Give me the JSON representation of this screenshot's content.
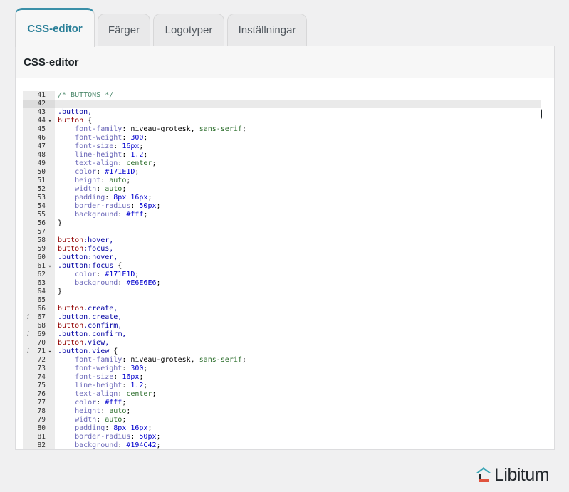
{
  "tabs": [
    {
      "label": "CSS-editor",
      "active": true
    },
    {
      "label": "Färger",
      "active": false
    },
    {
      "label": "Logotyper",
      "active": false
    },
    {
      "label": "Inställningar",
      "active": false
    }
  ],
  "panel": {
    "title": "CSS-editor"
  },
  "editor": {
    "lines": [
      {
        "n": "41",
        "parts": [
          [
            "/* BUTTONS */",
            "comment"
          ]
        ]
      },
      {
        "n": "42",
        "parts": []
      },
      {
        "n": "43",
        "parts": [
          [
            ".button,",
            "sel"
          ]
        ]
      },
      {
        "n": "44",
        "fold": true,
        "parts": [
          [
            "button",
            "tag"
          ],
          [
            " {",
            "plain"
          ]
        ]
      },
      {
        "n": "45",
        "parts": [
          [
            "    font-family",
            "prop"
          ],
          [
            ": niveau-grotesk, ",
            "plain"
          ],
          [
            "sans-serif",
            "str"
          ],
          [
            ";",
            "plain"
          ]
        ]
      },
      {
        "n": "46",
        "parts": [
          [
            "    font-weight",
            "prop"
          ],
          [
            ": ",
            "plain"
          ],
          [
            "300",
            "num"
          ],
          [
            ";",
            "plain"
          ]
        ]
      },
      {
        "n": "47",
        "parts": [
          [
            "    font-size",
            "prop"
          ],
          [
            ": ",
            "plain"
          ],
          [
            "16px",
            "num"
          ],
          [
            ";",
            "plain"
          ]
        ]
      },
      {
        "n": "48",
        "parts": [
          [
            "    line-height",
            "prop"
          ],
          [
            ": ",
            "plain"
          ],
          [
            "1.2",
            "num"
          ],
          [
            ";",
            "plain"
          ]
        ]
      },
      {
        "n": "49",
        "parts": [
          [
            "    text-align",
            "prop"
          ],
          [
            ": ",
            "plain"
          ],
          [
            "center",
            "str"
          ],
          [
            ";",
            "plain"
          ]
        ]
      },
      {
        "n": "50",
        "parts": [
          [
            "    color",
            "prop"
          ],
          [
            ": ",
            "plain"
          ],
          [
            "#171E1D",
            "num"
          ],
          [
            ";",
            "plain"
          ]
        ]
      },
      {
        "n": "51",
        "parts": [
          [
            "    height",
            "prop"
          ],
          [
            ": ",
            "plain"
          ],
          [
            "auto",
            "str"
          ],
          [
            ";",
            "plain"
          ]
        ]
      },
      {
        "n": "52",
        "parts": [
          [
            "    width",
            "prop"
          ],
          [
            ": ",
            "plain"
          ],
          [
            "auto",
            "str"
          ],
          [
            ";",
            "plain"
          ]
        ]
      },
      {
        "n": "53",
        "parts": [
          [
            "    padding",
            "prop"
          ],
          [
            ": ",
            "plain"
          ],
          [
            "8px 16px",
            "num"
          ],
          [
            ";",
            "plain"
          ]
        ]
      },
      {
        "n": "54",
        "parts": [
          [
            "    border-radius",
            "prop"
          ],
          [
            ": ",
            "plain"
          ],
          [
            "50px",
            "num"
          ],
          [
            ";",
            "plain"
          ]
        ]
      },
      {
        "n": "55",
        "parts": [
          [
            "    background",
            "prop"
          ],
          [
            ": ",
            "plain"
          ],
          [
            "#fff",
            "num"
          ],
          [
            ";",
            "plain"
          ]
        ]
      },
      {
        "n": "56",
        "parts": [
          [
            "}",
            "plain"
          ]
        ]
      },
      {
        "n": "57",
        "parts": []
      },
      {
        "n": "58",
        "parts": [
          [
            "button",
            "tag"
          ],
          [
            ":hover,",
            "sel"
          ]
        ]
      },
      {
        "n": "59",
        "parts": [
          [
            "button",
            "tag"
          ],
          [
            ":focus,",
            "sel"
          ]
        ]
      },
      {
        "n": "60",
        "parts": [
          [
            ".button:hover,",
            "sel"
          ]
        ]
      },
      {
        "n": "61",
        "fold": true,
        "parts": [
          [
            ".button:focus",
            "sel"
          ],
          [
            " {",
            "plain"
          ]
        ]
      },
      {
        "n": "62",
        "parts": [
          [
            "    color",
            "prop"
          ],
          [
            ": ",
            "plain"
          ],
          [
            "#171E1D",
            "num"
          ],
          [
            ";",
            "plain"
          ]
        ]
      },
      {
        "n": "63",
        "parts": [
          [
            "    background",
            "prop"
          ],
          [
            ": ",
            "plain"
          ],
          [
            "#E6E6E6",
            "num"
          ],
          [
            ";",
            "plain"
          ]
        ]
      },
      {
        "n": "64",
        "parts": [
          [
            "}",
            "plain"
          ]
        ]
      },
      {
        "n": "65",
        "parts": []
      },
      {
        "n": "66",
        "parts": [
          [
            "button",
            "tag"
          ],
          [
            ".create,",
            "sel"
          ]
        ]
      },
      {
        "n": "67",
        "info": true,
        "parts": [
          [
            ".button.create,",
            "sel"
          ]
        ]
      },
      {
        "n": "68",
        "parts": [
          [
            "button",
            "tag"
          ],
          [
            ".confirm,",
            "sel"
          ]
        ]
      },
      {
        "n": "69",
        "info": true,
        "parts": [
          [
            ".button.confirm,",
            "sel"
          ]
        ]
      },
      {
        "n": "70",
        "parts": [
          [
            "button",
            "tag"
          ],
          [
            ".view,",
            "sel"
          ]
        ]
      },
      {
        "n": "71",
        "info": true,
        "fold": true,
        "parts": [
          [
            ".button.view",
            "sel"
          ],
          [
            " {",
            "plain"
          ]
        ]
      },
      {
        "n": "72",
        "parts": [
          [
            "    font-family",
            "prop"
          ],
          [
            ": niveau-grotesk, ",
            "plain"
          ],
          [
            "sans-serif",
            "str"
          ],
          [
            ";",
            "plain"
          ]
        ]
      },
      {
        "n": "73",
        "parts": [
          [
            "    font-weight",
            "prop"
          ],
          [
            ": ",
            "plain"
          ],
          [
            "300",
            "num"
          ],
          [
            ";",
            "plain"
          ]
        ]
      },
      {
        "n": "74",
        "parts": [
          [
            "    font-size",
            "prop"
          ],
          [
            ": ",
            "plain"
          ],
          [
            "16px",
            "num"
          ],
          [
            ";",
            "plain"
          ]
        ]
      },
      {
        "n": "75",
        "parts": [
          [
            "    line-height",
            "prop"
          ],
          [
            ": ",
            "plain"
          ],
          [
            "1.2",
            "num"
          ],
          [
            ";",
            "plain"
          ]
        ]
      },
      {
        "n": "76",
        "parts": [
          [
            "    text-align",
            "prop"
          ],
          [
            ": ",
            "plain"
          ],
          [
            "center",
            "str"
          ],
          [
            ";",
            "plain"
          ]
        ]
      },
      {
        "n": "77",
        "parts": [
          [
            "    color",
            "prop"
          ],
          [
            ": ",
            "plain"
          ],
          [
            "#fff",
            "num"
          ],
          [
            ";",
            "plain"
          ]
        ]
      },
      {
        "n": "78",
        "parts": [
          [
            "    height",
            "prop"
          ],
          [
            ": ",
            "plain"
          ],
          [
            "auto",
            "str"
          ],
          [
            ";",
            "plain"
          ]
        ]
      },
      {
        "n": "79",
        "parts": [
          [
            "    width",
            "prop"
          ],
          [
            ": ",
            "plain"
          ],
          [
            "auto",
            "str"
          ],
          [
            ";",
            "plain"
          ]
        ]
      },
      {
        "n": "80",
        "parts": [
          [
            "    padding",
            "prop"
          ],
          [
            ": ",
            "plain"
          ],
          [
            "8px 16px",
            "num"
          ],
          [
            ";",
            "plain"
          ]
        ]
      },
      {
        "n": "81",
        "parts": [
          [
            "    border-radius",
            "prop"
          ],
          [
            ": ",
            "plain"
          ],
          [
            "50px",
            "num"
          ],
          [
            ";",
            "plain"
          ]
        ]
      },
      {
        "n": "82",
        "parts": [
          [
            "    background",
            "prop"
          ],
          [
            ": ",
            "plain"
          ],
          [
            "#194C42",
            "num"
          ],
          [
            ";",
            "plain"
          ]
        ]
      }
    ],
    "fold_glyph": "▾",
    "info_glyph": "i"
  },
  "brand": {
    "name": "Libitum",
    "colors": {
      "accent": "#2a7f98",
      "mark_teal": "#3aa5b5",
      "mark_dark": "#23282d",
      "mark_red": "#e0533d"
    },
    "icon": "libitum-house-icon"
  }
}
